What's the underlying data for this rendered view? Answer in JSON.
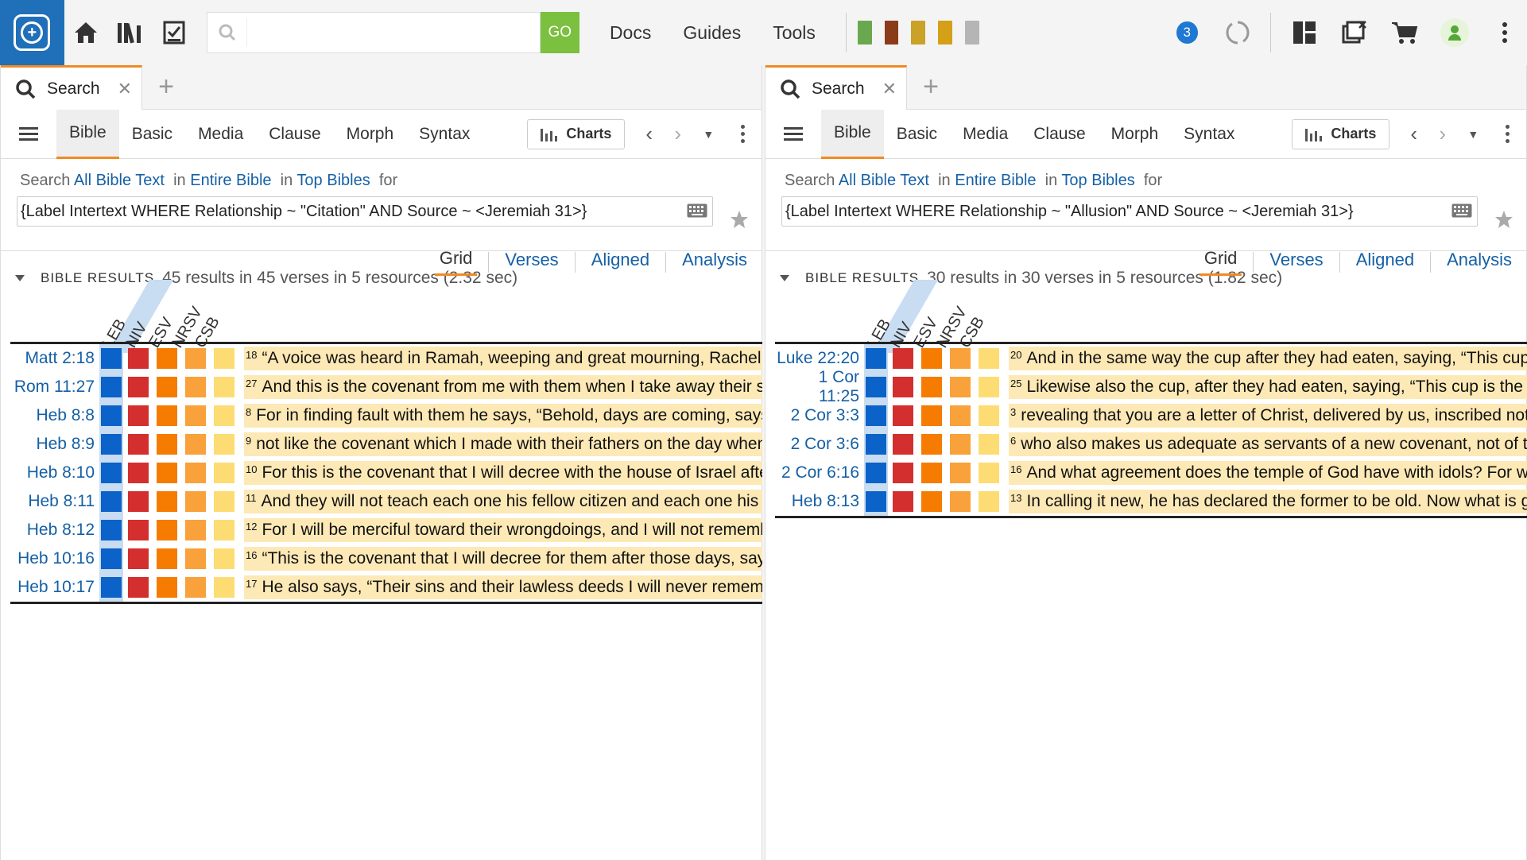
{
  "topbar": {
    "search_placeholder": "",
    "go_label": "GO",
    "menu": [
      "Docs",
      "Guides",
      "Tools"
    ],
    "notification_count": "3",
    "book_colors": [
      "#6aa84f",
      "#8b3a1a",
      "#c9a227",
      "#d4a017",
      "#b5b5b5"
    ]
  },
  "colors": {
    "LEB": "#0b62c9",
    "NIV": "#d32f2f",
    "ESV": "#f57c00",
    "NRSV": "#f9a13a",
    "CSB": "#fddc74"
  },
  "panels": [
    {
      "tab_label": "Search",
      "subtabs": [
        "Bible",
        "Basic",
        "Media",
        "Clause",
        "Morph",
        "Syntax"
      ],
      "charts_label": "Charts",
      "query_line": {
        "prefix": "Search",
        "scope": "All Bible Text",
        "in1": "in",
        "range": "Entire Bible",
        "in2": "in",
        "collection": "Top Bibles",
        "for": "for"
      },
      "query": "{Label Intertext WHERE Relationship ~ \"Citation\" AND Source ~ <Jeremiah 31>}",
      "results_title": "BIBLE RESULTS",
      "results_summary": "45 results in 45 verses in 5 resources (2.32 sec)",
      "view_tabs": [
        "Grid",
        "Verses",
        "Aligned",
        "Analysis"
      ],
      "columns": [
        "LEB",
        "NIV",
        "ESV",
        "NRSV",
        "CSB"
      ],
      "rows": [
        {
          "ref": "Matt 2:18",
          "num": "18",
          "text": "“A voice was heard in Ramah, weeping and great mourning, Rachel weeping for her children"
        },
        {
          "ref": "Rom 11:27",
          "num": "27",
          "text": "And this is the covenant from me with them when I take away their sins.”"
        },
        {
          "ref": "Heb 8:8",
          "num": "8",
          "text": "For in finding fault with them he says, “Behold, days are coming, says the Lord"
        },
        {
          "ref": "Heb 8:9",
          "num": "9",
          "text": "not like the covenant which I made with their fathers on the day when I took them"
        },
        {
          "ref": "Heb 8:10",
          "num": "10",
          "text": "For this is the covenant that I will decree with the house of Israel after those days"
        },
        {
          "ref": "Heb 8:11",
          "num": "11",
          "text": "And they will not teach each one his fellow citizen and each one his brother"
        },
        {
          "ref": "Heb 8:12",
          "num": "12",
          "text": "For I will be merciful toward their wrongdoings, and I will not remember their sins"
        },
        {
          "ref": "Heb 10:16",
          "num": "16",
          "text": "“This is the covenant that I will decree for them after those days, says the Lord"
        },
        {
          "ref": "Heb 10:17",
          "num": "17",
          "text": "He also says, “Their sins and their lawless deeds I will never remember any longer.”"
        }
      ]
    },
    {
      "tab_label": "Search",
      "subtabs": [
        "Bible",
        "Basic",
        "Media",
        "Clause",
        "Morph",
        "Syntax"
      ],
      "charts_label": "Charts",
      "query_line": {
        "prefix": "Search",
        "scope": "All Bible Text",
        "in1": "in",
        "range": "Entire Bible",
        "in2": "in",
        "collection": "Top Bibles",
        "for": "for"
      },
      "query": "{Label Intertext WHERE Relationship ~ \"Allusion\" AND Source ~ <Jeremiah 31>}",
      "results_title": "BIBLE RESULTS",
      "results_summary": "30 results in 30 verses in 5 resources (1.82 sec)",
      "view_tabs": [
        "Grid",
        "Verses",
        "Aligned",
        "Analysis"
      ],
      "columns": [
        "LEB",
        "NIV",
        "ESV",
        "NRSV",
        "CSB"
      ],
      "rows": [
        {
          "ref": "Luke 22:20",
          "num": "20",
          "text": "And in the same way the cup after they had eaten, saying, “This cup is the new covenant"
        },
        {
          "ref": "1 Cor 11:25",
          "num": "25",
          "text": "Likewise also the cup, after they had eaten, saying, “This cup is the new covenant"
        },
        {
          "ref": "2 Cor 3:3",
          "num": "3",
          "text": "revealing that you are a letter of Christ, delivered by us, inscribed not with ink"
        },
        {
          "ref": "2 Cor 3:6",
          "num": "6",
          "text": "who also makes us adequate as servants of a new covenant, not of the letter"
        },
        {
          "ref": "2 Cor 6:16",
          "num": "16",
          "text": "And what agreement does the temple of God have with idols? For we are the temple"
        },
        {
          "ref": "Heb 8:13",
          "num": "13",
          "text": "In calling it new, he has declared the former to be old. Now what is growing old"
        }
      ]
    }
  ]
}
